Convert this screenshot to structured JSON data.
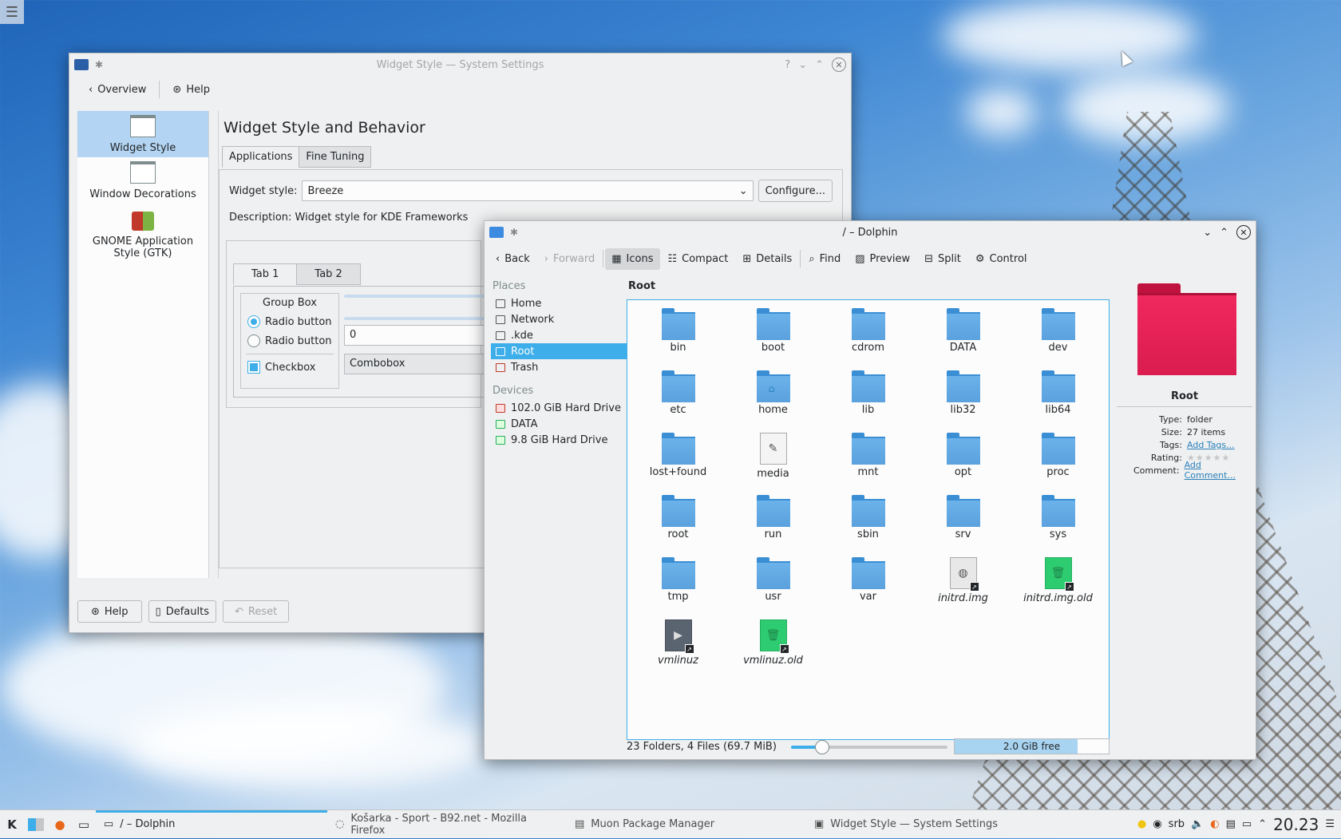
{
  "desktop": {
    "menu_glyph": "☰"
  },
  "settings_window": {
    "title": "Widget Style — System Settings",
    "toolbar": {
      "overview": "Overview",
      "help": "Help"
    },
    "sidebar": [
      {
        "label": "Widget Style"
      },
      {
        "label": "Window Decorations"
      },
      {
        "label": "GNOME Application Style (GTK)"
      }
    ],
    "heading": "Widget Style and Behavior",
    "tabs": [
      "Applications",
      "Fine Tuning"
    ],
    "widget_style_label": "Widget style:",
    "widget_style_value": "Breeze",
    "configure_label": "Configure...",
    "description": "Description: Widget style for KDE Frameworks",
    "preview": {
      "tabs": [
        "Tab 1",
        "Tab 2"
      ],
      "group_box": "Group Box",
      "radio1": "Radio button",
      "radio2": "Radio button",
      "checkbox": "Checkbox",
      "spin_value": "0",
      "combobox": "Combobox"
    },
    "bottom_buttons": {
      "help": "Help",
      "defaults": "Defaults",
      "reset": "Reset"
    }
  },
  "dolphin": {
    "title": "/ – Dolphin",
    "toolbar": {
      "back": "Back",
      "forward": "Forward",
      "icons": "Icons",
      "compact": "Compact",
      "details": "Details",
      "find": "Find",
      "preview": "Preview",
      "split": "Split",
      "control": "Control"
    },
    "places_heading": "Places",
    "places": [
      {
        "label": "Home",
        "selected": false
      },
      {
        "label": "Network",
        "selected": false
      },
      {
        "label": ".kde",
        "selected": false
      },
      {
        "label": "Root",
        "selected": true
      },
      {
        "label": "Trash",
        "selected": false
      }
    ],
    "devices_heading": "Devices",
    "devices": [
      {
        "label": "102.0 GiB Hard Drive"
      },
      {
        "label": "DATA"
      },
      {
        "label": "9.8 GiB Hard Drive"
      }
    ],
    "breadcrumb": "Root",
    "files": [
      {
        "name": "bin",
        "kind": "folder"
      },
      {
        "name": "boot",
        "kind": "folder"
      },
      {
        "name": "cdrom",
        "kind": "folder"
      },
      {
        "name": "DATA",
        "kind": "folder"
      },
      {
        "name": "dev",
        "kind": "folder"
      },
      {
        "name": "etc",
        "kind": "folder"
      },
      {
        "name": "home",
        "kind": "home"
      },
      {
        "name": "lib",
        "kind": "folder"
      },
      {
        "name": "lib32",
        "kind": "folder"
      },
      {
        "name": "lib64",
        "kind": "folder"
      },
      {
        "name": "lost+found",
        "kind": "folder"
      },
      {
        "name": "media",
        "kind": "media"
      },
      {
        "name": "mnt",
        "kind": "folder"
      },
      {
        "name": "opt",
        "kind": "folder"
      },
      {
        "name": "proc",
        "kind": "folder"
      },
      {
        "name": "root",
        "kind": "folder"
      },
      {
        "name": "run",
        "kind": "folder"
      },
      {
        "name": "sbin",
        "kind": "folder"
      },
      {
        "name": "srv",
        "kind": "folder"
      },
      {
        "name": "sys",
        "kind": "folder"
      },
      {
        "name": "tmp",
        "kind": "folder"
      },
      {
        "name": "usr",
        "kind": "folder"
      },
      {
        "name": "var",
        "kind": "folder"
      },
      {
        "name": "initrd.img",
        "kind": "link-gray"
      },
      {
        "name": "initrd.img.old",
        "kind": "link-green"
      },
      {
        "name": "vmlinuz",
        "kind": "link-dark"
      },
      {
        "name": "vmlinuz.old",
        "kind": "link-green"
      }
    ],
    "info": {
      "name": "Root",
      "rows": [
        {
          "k": "Type:",
          "v": "folder",
          "link": false
        },
        {
          "k": "Size:",
          "v": "27 items",
          "link": false
        },
        {
          "k": "Tags:",
          "v": "Add Tags...",
          "link": true
        },
        {
          "k": "Rating:",
          "v": "★★★★★",
          "stars": true
        },
        {
          "k": "Comment:",
          "v": "Add Comment...",
          "link": true
        }
      ]
    },
    "status_text": "23 Folders, 4 Files (69.7 MiB)",
    "zoom_fraction": 0.2,
    "free_space": "2.0 GiB free",
    "used_fraction": 0.8
  },
  "taskbar": {
    "tasks": [
      {
        "label": "/ – Dolphin",
        "active": true
      },
      {
        "label": "Košarka - Sport - B92.net - Mozilla Firefox",
        "active": false
      },
      {
        "label": "Muon Package Manager",
        "active": false
      },
      {
        "label": "Widget Style — System Settings",
        "active": false
      }
    ],
    "keyboard_layout": "srb",
    "clock": "20.23"
  }
}
